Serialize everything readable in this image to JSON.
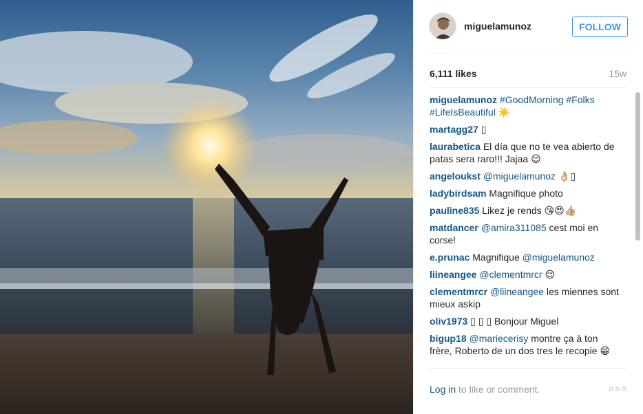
{
  "post": {
    "username": "miguelamunoz",
    "follow_label": "FOLLOW",
    "likes": "6,111 likes",
    "age": "15w"
  },
  "caption": {
    "user": "miguelamunoz",
    "text": "#GoodMorning #Folks #LifeIsBeautiful ☀️"
  },
  "comments": [
    {
      "user": "martagg27",
      "parts": [
        {
          "t": "▯",
          "tag": false
        }
      ]
    },
    {
      "user": "laurabetica",
      "parts": [
        {
          "t": "El día que no te vea abierto de patas sera raro!!! Jajaa 😌",
          "tag": false
        }
      ]
    },
    {
      "user": "angeloukst",
      "parts": [
        {
          "t": "@miguelamunoz",
          "tag": true
        },
        {
          "t": " 👌🏼▯",
          "tag": false
        }
      ]
    },
    {
      "user": "ladybirdsam",
      "parts": [
        {
          "t": "Magnifique photo",
          "tag": false
        }
      ]
    },
    {
      "user": "pauline835",
      "parts": [
        {
          "t": "Likez je rends 😘😍👍🏼",
          "tag": false
        }
      ]
    },
    {
      "user": "matdancer",
      "parts": [
        {
          "t": "@amira311085",
          "tag": true
        },
        {
          "t": " cest moi en corse!",
          "tag": false
        }
      ]
    },
    {
      "user": "e.prunac",
      "parts": [
        {
          "t": "Magnifique ",
          "tag": false
        },
        {
          "t": "@miguelamunoz",
          "tag": true
        }
      ]
    },
    {
      "user": "liineangee",
      "parts": [
        {
          "t": "@clementmrcr",
          "tag": true
        },
        {
          "t": " 😌",
          "tag": false
        }
      ]
    },
    {
      "user": "clementmrcr",
      "parts": [
        {
          "t": "@liineangee",
          "tag": true
        },
        {
          "t": " les miennes sont mieux askip",
          "tag": false
        }
      ]
    },
    {
      "user": "oliv1973",
      "parts": [
        {
          "t": "▯ ▯ ▯ Bonjour Miguel",
          "tag": false
        }
      ]
    },
    {
      "user": "bigup18",
      "parts": [
        {
          "t": "@mariecerisy",
          "tag": true
        },
        {
          "t": " montre ça à ton frère, Roberto de un dos tres le recopie 😁",
          "tag": false
        }
      ]
    }
  ],
  "footer": {
    "login_label": "Log in",
    "rest": " to like or comment.",
    "more_label": "○○○"
  },
  "colors": {
    "link": "#125688",
    "accent": "#3897f0",
    "muted": "#999999"
  }
}
